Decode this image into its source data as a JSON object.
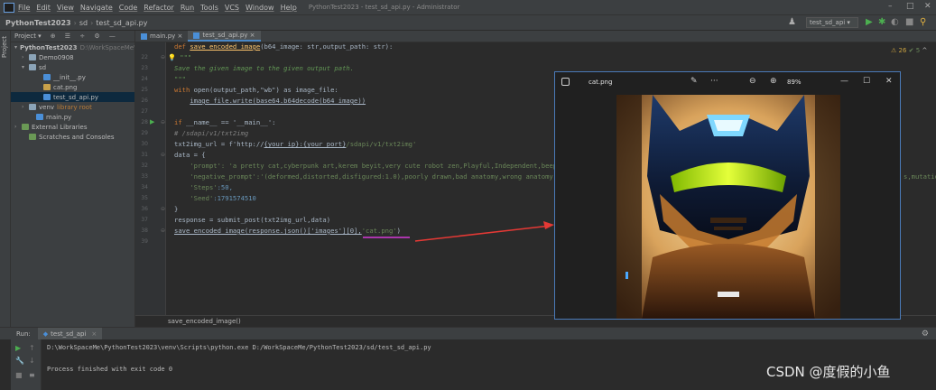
{
  "titlebar": {
    "menu": [
      "File",
      "Edit",
      "View",
      "Navigate",
      "Code",
      "Refactor",
      "Run",
      "Tools",
      "VCS",
      "Window",
      "Help"
    ],
    "window_title": "PythonTest2023 - test_sd_api.py - Administrator",
    "minimize": "–",
    "maximize": "□",
    "close": "✕"
  },
  "navbar": {
    "crumbs": [
      "PythonTest2023",
      "sd",
      "test_sd_api.py"
    ],
    "run_config": "test_sd_api ▾"
  },
  "left_stripe": {
    "label": "Project"
  },
  "project_panel": {
    "title": "Project ▾",
    "tree": [
      {
        "label": "PythonTest2023",
        "extra": "D:\\WorkSpaceMe\\",
        "indent": 0,
        "chev": "▾",
        "icon": "folder"
      },
      {
        "label": "Demo0908",
        "extra": "",
        "indent": 1,
        "chev": "›",
        "icon": "folder"
      },
      {
        "label": "sd",
        "extra": "",
        "indent": 1,
        "chev": "▾",
        "icon": "folder"
      },
      {
        "label": "__init__.py",
        "extra": "",
        "indent": 3,
        "chev": "",
        "icon": "py"
      },
      {
        "label": "cat.png",
        "extra": "",
        "indent": 3,
        "chev": "",
        "icon": "png"
      },
      {
        "label": "test_sd_api.py",
        "extra": "",
        "indent": 3,
        "chev": "",
        "icon": "py",
        "selected": true
      },
      {
        "label": "venv",
        "extra": "library root",
        "indent": 1,
        "chev": "›",
        "icon": "folder",
        "orange": true
      },
      {
        "label": "main.py",
        "extra": "",
        "indent": 2,
        "chev": "",
        "icon": "py"
      },
      {
        "label": "External Libraries",
        "extra": "",
        "indent": 0,
        "chev": "›",
        "icon": "lib"
      },
      {
        "label": "Scratches and Consoles",
        "extra": "",
        "indent": 1,
        "chev": "",
        "icon": "lib"
      }
    ]
  },
  "editor_tabs": [
    {
      "label": "main.py ×",
      "active": false
    },
    {
      "label": "test_sd_api.py ×",
      "active": true
    }
  ],
  "gutter": {
    "line_numbers": [
      "",
      "22",
      "23",
      "24",
      "25",
      "26",
      "27",
      "28",
      "29",
      "30",
      "31",
      "32",
      "33",
      "34",
      "35",
      "36",
      "37",
      "38",
      "39"
    ]
  },
  "code": {
    "l0_def": "def ",
    "l0_name": "save_encoded_image",
    "l0_rest": "(b64_image: str,output_path: str):",
    "l1": "\"\"\"",
    "l2": "Save the given image to the given output path.",
    "l3": "\"\"\"",
    "l4_kw": "with ",
    "l4_rest": "open(output_path,\"wb\") as image_file:",
    "l5": "image_file.write(base64.b64decode(b64_image))",
    "l7_kw": "if ",
    "l7_rest": "__name__ == '__main__':",
    "l8": "# /sdapi/v1/txt2img",
    "l9_a": "txt2img_url = f'http://",
    "l9_b": "{your_ip}:{your_port}",
    "l9_c": "/sdapi/v1/txt2img'",
    "l10": "data = {",
    "l11": "'prompt': 'a pretty cat,cyberpunk art,kerem beyit,very cute robot zen,Playful,Independent,beep",
    "l12": "'negative_prompt':'(deformed,distorted,disfigured:1.0),poorly drawn,bad anatomy,wrong anatomy,",
    "l12_tail": "s,mutatio",
    "l13_a": "'Steps'",
    "l13_b": ":50,",
    "l14_a": "'Seed'",
    "l14_b": ":1791574510",
    "l15": "}",
    "l16": "response = submit_post(txt2img_url,data)",
    "l17_a": "save_encoded_image(response.json()['images'][0],",
    "l17_b": "'cat.png'",
    "l17_c": ")"
  },
  "inspection": {
    "warn": "⚠ 26",
    "ok": "✔ 5",
    "caret": "^"
  },
  "breadcrumb_bar": {
    "text": "save_encoded_image()"
  },
  "run_panel": {
    "label": "Run:",
    "tab": "test_sd_api",
    "console": [
      "D:\\WorkSpaceMe\\PythonTest2023\\venv\\Scripts\\python.exe D:/WorkSpaceMe/PythonTest2023/sd/test_sd_api.py",
      "",
      "Process finished with exit code 0"
    ]
  },
  "photo_viewer": {
    "filename": "cat.png",
    "zoom": "89%",
    "zoom_out": "⊖",
    "zoom_in": "⊕",
    "more": "···",
    "minimize": "—",
    "maximize": "☐",
    "close": "✕"
  },
  "watermark": "CSDN @度假的小鱼",
  "colors": {
    "accent": "#4a88c7",
    "annotation_arrow": "#e53935",
    "annotation_underline": "#d63bd8"
  }
}
